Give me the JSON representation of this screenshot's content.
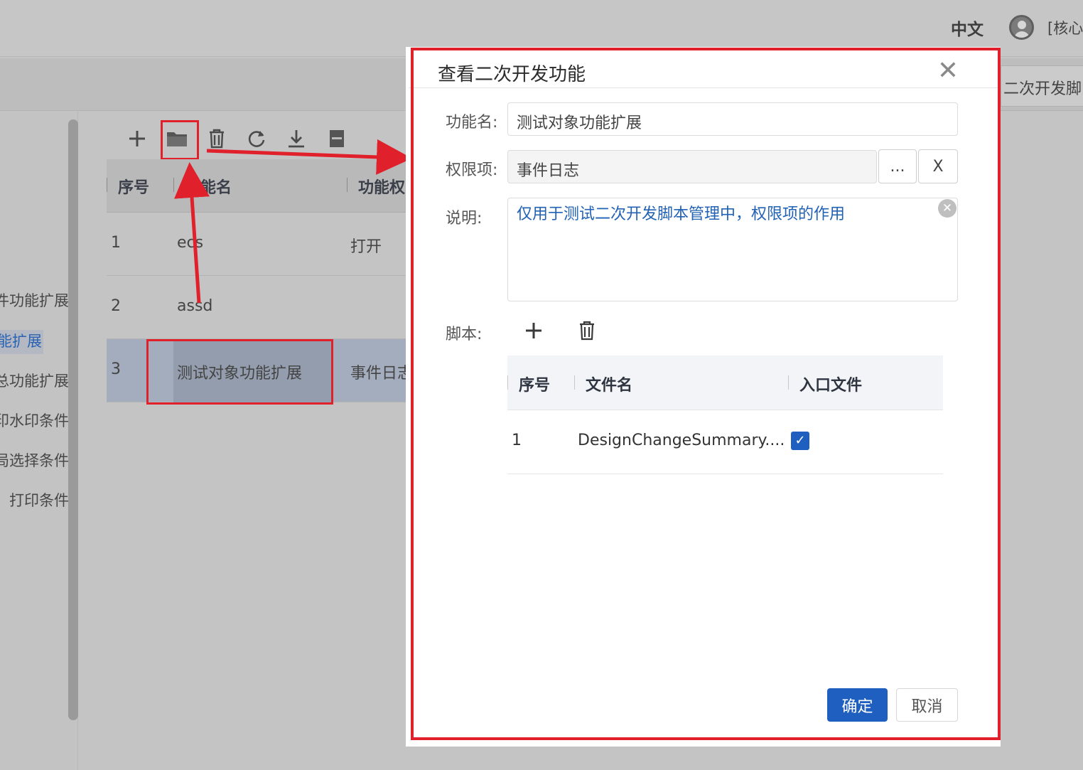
{
  "header": {
    "language": "中文",
    "user_label": "[核心"
  },
  "tabs": {
    "right_tab_label": "二次开发脚"
  },
  "left_nav": {
    "items": [
      {
        "label": "件功能扩展"
      },
      {
        "label": "能扩展"
      },
      {
        "label": "总功能扩展"
      },
      {
        "label": "印水印条件"
      },
      {
        "label": "局选择条件"
      },
      {
        "label": "打印条件"
      }
    ]
  },
  "toolbar": {
    "icons": [
      "add-icon",
      "folder-open-icon",
      "delete-icon",
      "refresh-icon",
      "download-icon",
      "archive-icon"
    ]
  },
  "list_table": {
    "columns": [
      "序号",
      "功能名",
      "功能权"
    ],
    "rows": [
      {
        "index": "1",
        "name": "ecs",
        "permission": "打开"
      },
      {
        "index": "2",
        "name": "assd",
        "permission": ""
      },
      {
        "index": "3",
        "name": "测试对象功能扩展",
        "permission": "事件日志"
      }
    ]
  },
  "dialog": {
    "title": "查看二次开发功能",
    "close_symbol": "✕",
    "fields": {
      "name_label": "功能名:",
      "name_value": "测试对象功能扩展",
      "permission_label": "权限项:",
      "permission_value": "事件日志",
      "permission_select_label": "...",
      "permission_clear_label": "X",
      "description_label": "说明:",
      "description_value": "仅用于测试二次开发脚本管理中，权限项的作用",
      "script_label": "脚本:"
    },
    "script_table": {
      "columns": [
        "序号",
        "文件名",
        "入口文件"
      ],
      "rows": [
        {
          "index": "1",
          "filename": "DesignChangeSummary....",
          "is_entry": true
        }
      ]
    },
    "buttons": {
      "confirm": "确定",
      "cancel": "取消"
    }
  },
  "colors": {
    "primary": "#1f5fbf",
    "annotation_red": "#e0202b",
    "description_text": "#2262b5"
  }
}
